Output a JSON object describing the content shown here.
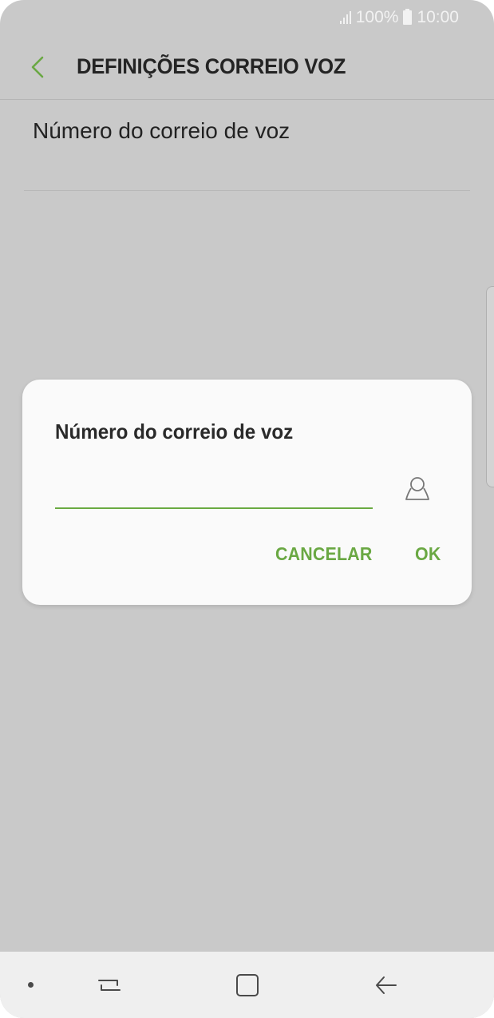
{
  "status_bar": {
    "battery": "100%",
    "time": "10:00"
  },
  "app_bar": {
    "title": "DEFINIÇÕES CORREIO VOZ"
  },
  "settings": {
    "items": [
      {
        "label": "Número do correio de voz"
      }
    ]
  },
  "dialog": {
    "title": "Número do correio de voz",
    "input_value": "",
    "cancel_label": "CANCELAR",
    "ok_label": "OK"
  },
  "nav_bar": {
    "icons": [
      "recent-apps-icon",
      "home-icon",
      "back-icon"
    ]
  },
  "colors": {
    "accent": "#6aa843",
    "scrim": "#c9c9c9",
    "dialog_bg": "#fafafa"
  }
}
